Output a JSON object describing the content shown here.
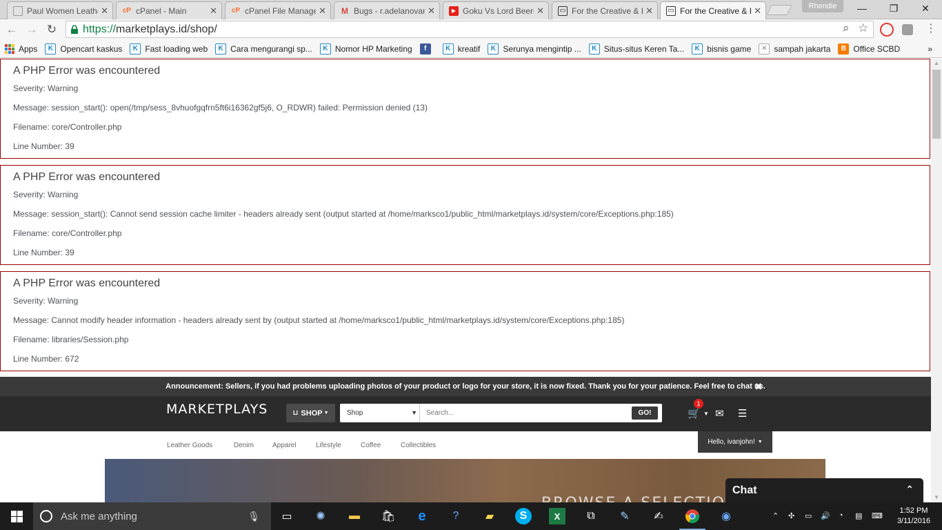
{
  "browser": {
    "tabs": [
      {
        "title": "Paul Women Leathe",
        "favicon": "page-icon",
        "color": "#777"
      },
      {
        "title": "cPanel - Main",
        "favicon": "cpanel-icon",
        "color": "#ff6c2c"
      },
      {
        "title": "cPanel File Manager",
        "favicon": "cpanel-icon",
        "color": "#ff6c2c"
      },
      {
        "title": "Bugs - r.adelanovan",
        "favicon": "gmail-icon",
        "color": "#d44638"
      },
      {
        "title": "Goku Vs Lord Beeru",
        "favicon": "youtube-icon",
        "color": "#e62117"
      },
      {
        "title": "For the Creative & I",
        "favicon": "marketplays-icon",
        "color": "#333"
      },
      {
        "title": "For the Creative & I",
        "favicon": "marketplays-icon",
        "color": "#333"
      }
    ],
    "profile": "Rhendie",
    "window_controls": {
      "minimize": "—",
      "maximize": "❐",
      "close": "✕"
    },
    "url_scheme": "https://",
    "url_rest": "marketplays.id/shop/",
    "bookmarks": [
      {
        "label": "Apps",
        "icon": "apps-grid-icon"
      },
      {
        "label": "Opencart kaskus",
        "icon": "kaskus-icon"
      },
      {
        "label": "Fast loading web",
        "icon": "kaskus-icon"
      },
      {
        "label": "Cara mengurangi sp...",
        "icon": "kaskus-icon"
      },
      {
        "label": "Nomor HP Marketing",
        "icon": "kaskus-icon"
      },
      {
        "label": "",
        "icon": "facebook-icon"
      },
      {
        "label": "kreatif",
        "icon": "kaskus-icon"
      },
      {
        "label": "Serunya mengintip ...",
        "icon": "kaskus-icon"
      },
      {
        "label": "Situs-situs Keren Ta...",
        "icon": "kaskus-icon"
      },
      {
        "label": "bisnis game",
        "icon": "kaskus-icon"
      },
      {
        "label": "sampah jakarta",
        "icon": "trash-icon"
      },
      {
        "label": "Office SCBD",
        "icon": "blogger-icon"
      }
    ],
    "bookmarks_overflow": "»"
  },
  "errors": [
    {
      "heading": "A PHP Error was encountered",
      "severity": "Severity: Warning",
      "message": "Message: session_start(): open(/tmp/sess_8vhuofgqfrn5ft6i16362gf5j6, O_RDWR) failed: Permission denied (13)",
      "filename": "Filename: core/Controller.php",
      "line": "Line Number: 39"
    },
    {
      "heading": "A PHP Error was encountered",
      "severity": "Severity: Warning",
      "message": "Message: session_start(): Cannot send session cache limiter - headers already sent (output started at /home/marksco1/public_html/marketplays.id/system/core/Exceptions.php:185)",
      "filename": "Filename: core/Controller.php",
      "line": "Line Number: 39"
    },
    {
      "heading": "A PHP Error was encountered",
      "severity": "Severity: Warning",
      "message": "Message: Cannot modify header information - headers already sent by (output started at /home/marksco1/public_html/marketplays.id/system/core/Exceptions.php:185)",
      "filename": "Filename: libraries/Session.php",
      "line": "Line Number: 672"
    }
  ],
  "site": {
    "announcement_label": "Announcement:",
    "announcement_text": " Sellers, if you had problems uploading photos of your product or logo for your store, it is now fixed. Thank you for your patience. Feel free to chat us.",
    "logo": "MARKETPLAYS",
    "shop_button": "SHOP",
    "search_category": "Shop",
    "search_placeholder": "Search...",
    "go_button": "GO!",
    "cart_count": "1",
    "categories": [
      "Leather Goods",
      "Denim",
      "Apparel",
      "Lifestyle",
      "Coffee",
      "Collectibles"
    ],
    "greeting": "Hello, ivanjohn!",
    "hero_text": "BROWSE A SELECTION",
    "chat_label": "Chat"
  },
  "taskbar": {
    "search_placeholder": "Ask me anything",
    "time": "1:52 PM",
    "date": "3/11/2016"
  }
}
